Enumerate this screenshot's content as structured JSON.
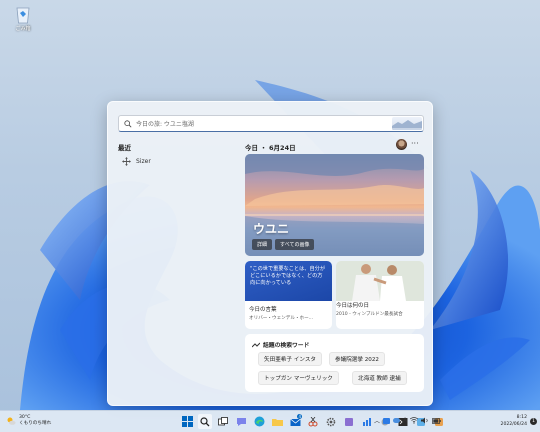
{
  "desktop": {
    "recycle_bin_label": "ごみ箱"
  },
  "widgets": {
    "search_placeholder": "今日の旅: ウユニ塩湖",
    "left_title": "最近",
    "recent_items": [
      {
        "label": "Sizer",
        "icon": "move-arrows-icon"
      }
    ],
    "date_header": "今日 ・ 6月24日",
    "more_label": "···",
    "hero": {
      "title": "ウユニ",
      "details_button": "詳細",
      "all_images_button": "すべての画像"
    },
    "quote_card": {
      "quote": "\"この世で重要なことは、自分がどこにいるかではなく、どの方向に向かっている",
      "title": "今日の言葉",
      "subtitle": "オリバー・ウェンデル・ホー..."
    },
    "sport_card": {
      "title": "今日は何の日",
      "subtitle": "2010 - ウィンブルドン最長試合"
    },
    "trending": {
      "title": "話題の検索ワード",
      "items": [
        "矢田亜希子 インスタ",
        "参議院選挙 2022",
        "トップガン マーヴェリック",
        "北海道 教師 逮捕"
      ]
    }
  },
  "taskbar": {
    "weather_temp": "30°C",
    "weather_desc": "くもりのち晴れ",
    "ime_label": "A",
    "time": "8:12",
    "date": "2022/06/24",
    "notification_count": "1",
    "mail_badge": "4",
    "icons": [
      "windows-start-icon",
      "search-icon",
      "task-view-icon",
      "chat-icon",
      "edge-icon",
      "file-explorer-icon",
      "mail-icon",
      "snipping-icon",
      "settings-icon",
      "app-icon",
      "chart-app-icon",
      "gear-app-icon",
      "terminal-icon",
      "app-icon-2",
      "app-icon-3"
    ],
    "accent_color": "#0067c0"
  }
}
